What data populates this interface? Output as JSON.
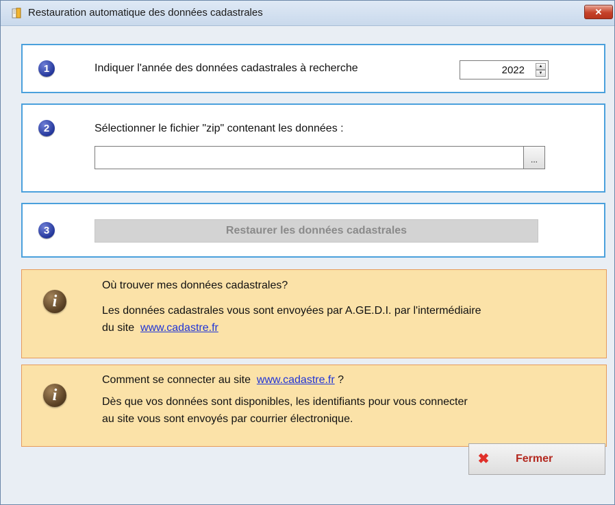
{
  "window": {
    "title": "Restauration automatique des données cadastrales",
    "close_label": "✕"
  },
  "step1": {
    "number": "1",
    "label": "Indiquer l'année des données cadastrales à recherche",
    "year_value": "2022"
  },
  "step2": {
    "number": "2",
    "label": "Sélectionner le fichier \"zip\" contenant les données :",
    "file_value": "",
    "browse_label": "..."
  },
  "step3": {
    "number": "3",
    "restore_label": "Restaurer les données cadastrales"
  },
  "info1": {
    "icon_letter": "i",
    "heading": "Où trouver mes données cadastrales?",
    "line1": "Les données cadastrales vous sont envoyées par A.GE.D.I. par l'intermédiaire",
    "line2_prefix": "du site",
    "link": "www.cadastre.fr"
  },
  "info2": {
    "icon_letter": "i",
    "heading_prefix": "Comment se connecter au site",
    "link": "www.cadastre.fr",
    "heading_suffix": "?",
    "line1": "Dès que vos données sont disponibles, les identifiants pour vous connecter",
    "line2": "au site vous sont envoyés par courrier électronique."
  },
  "footer": {
    "close_label": "Fermer"
  },
  "colors": {
    "panel_border": "#4aa0dc",
    "info_bg": "#fbe2a8",
    "info_border": "#e69a5a",
    "step_circle": "#24379b",
    "link": "#1f34d6",
    "close_text": "#b3281f"
  }
}
